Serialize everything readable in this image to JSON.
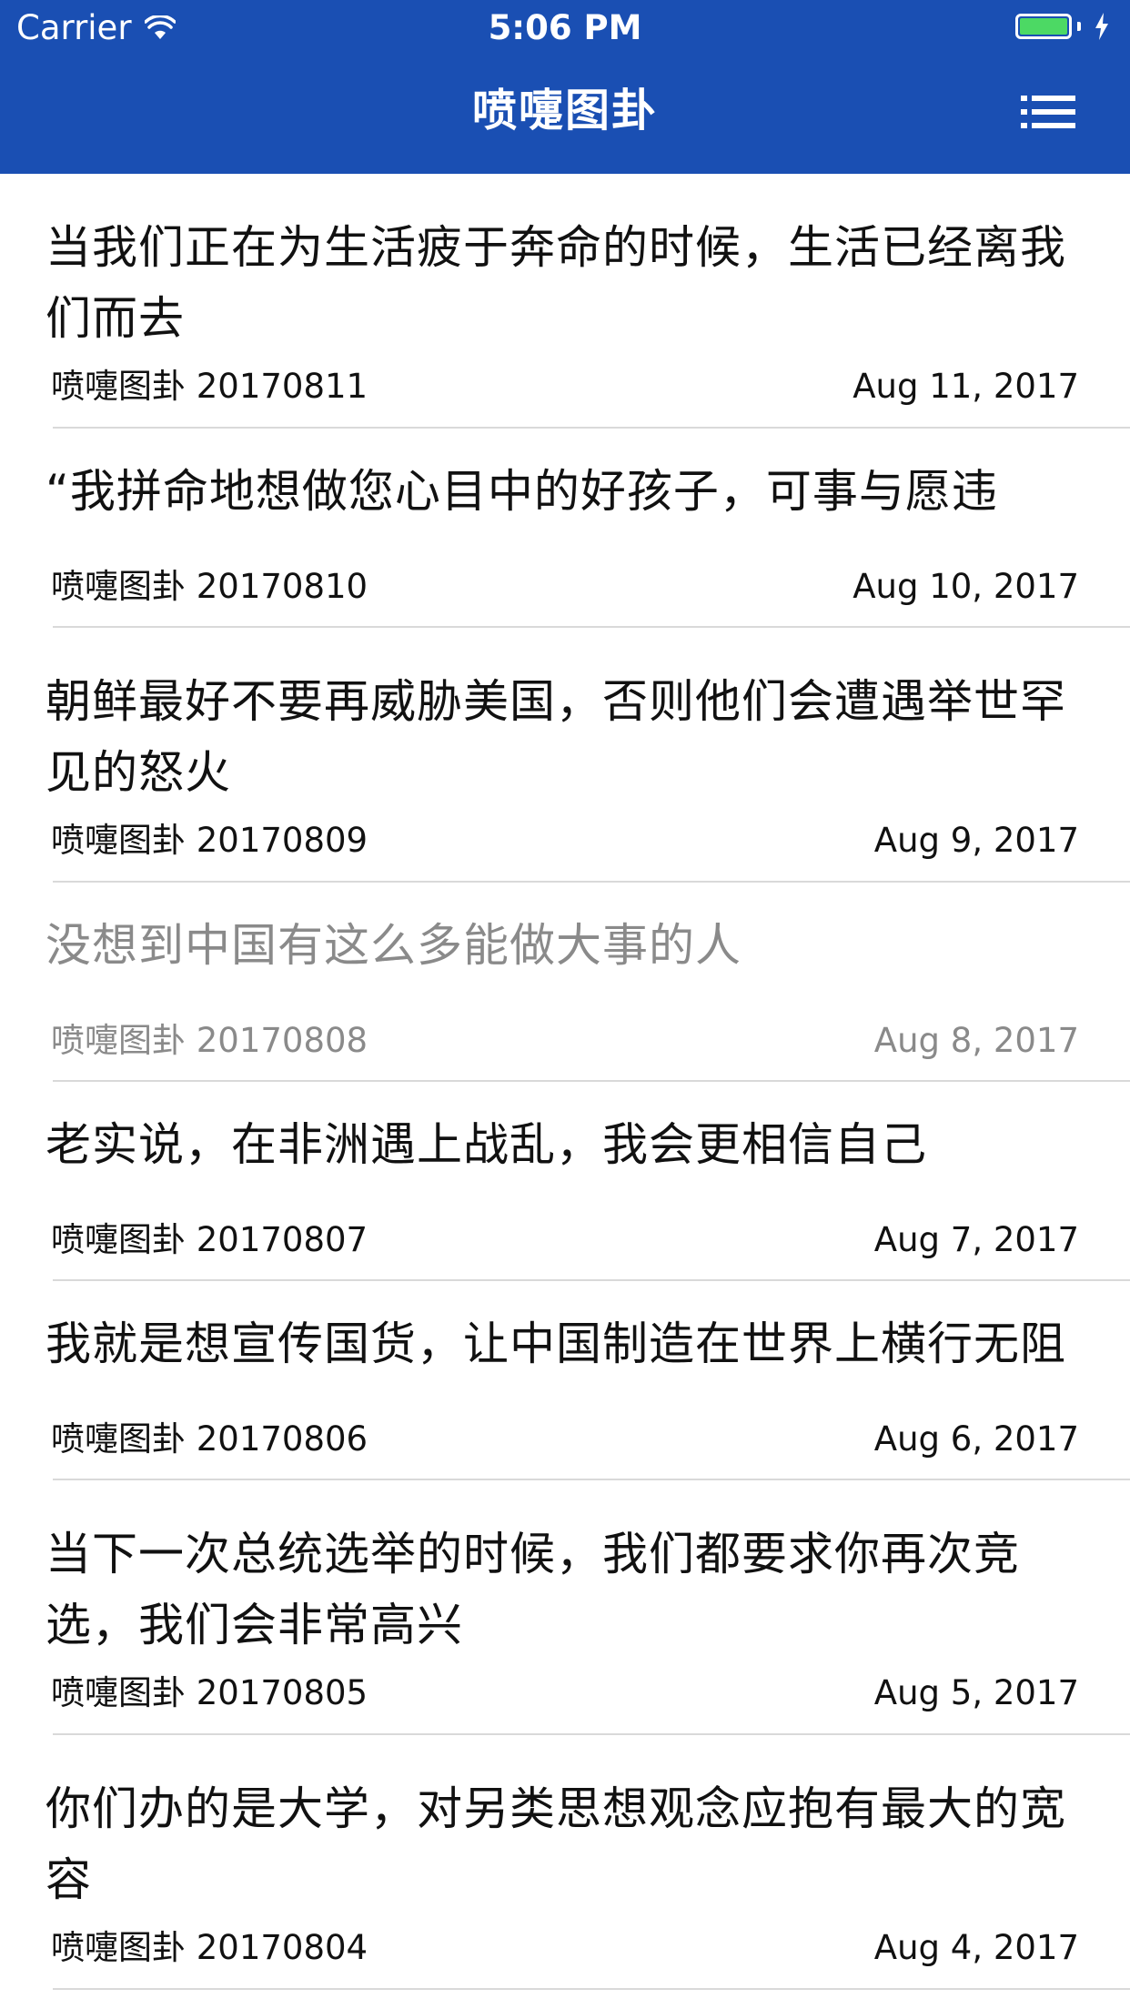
{
  "status_bar": {
    "carrier": "Carrier",
    "time": "5:06 PM",
    "wifi_icon": "wifi-icon",
    "battery_icon": "battery-icon",
    "charging_icon": "bolt-icon",
    "battery_level": 1.0,
    "battery_color": "#4cd964"
  },
  "nav": {
    "title": "喷嚏图卦",
    "menu_icon": "menu-list-icon",
    "background_color": "#1a4fb3"
  },
  "articles": [
    {
      "title": "当我们正在为生活疲于奔命的时候，生活已经离我们而去",
      "source": "喷嚏图卦 20170811",
      "date": "Aug 11, 2017",
      "read": false
    },
    {
      "title": "“我拼命地想做您心目中的好孩子，可事与愿违",
      "source": "喷嚏图卦 20170810",
      "date": "Aug 10, 2017",
      "read": false
    },
    {
      "title": "朝鲜最好不要再威胁美国，否则他们会遭遇举世罕见的怒火",
      "source": "喷嚏图卦 20170809",
      "date": "Aug 9, 2017",
      "read": false
    },
    {
      "title": "没想到中国有这么多能做大事的人",
      "source": "喷嚏图卦 20170808",
      "date": "Aug 8, 2017",
      "read": true
    },
    {
      "title": "老实说，在非洲遇上战乱，我会更相信自己",
      "source": "喷嚏图卦 20170807",
      "date": "Aug 7, 2017",
      "read": false
    },
    {
      "title": "我就是想宣传国货，让中国制造在世界上横行无阻",
      "source": "喷嚏图卦 20170806",
      "date": "Aug 6, 2017",
      "read": false
    },
    {
      "title": "当下一次总统选举的时候，我们都要求你再次竞选，我们会非常高兴",
      "source": "喷嚏图卦 20170805",
      "date": "Aug 5, 2017",
      "read": false
    },
    {
      "title": "你们办的是大学，对另类思想观念应抱有最大的宽容",
      "source": "喷嚏图卦 20170804",
      "date": "Aug 4, 2017",
      "read": false
    }
  ]
}
